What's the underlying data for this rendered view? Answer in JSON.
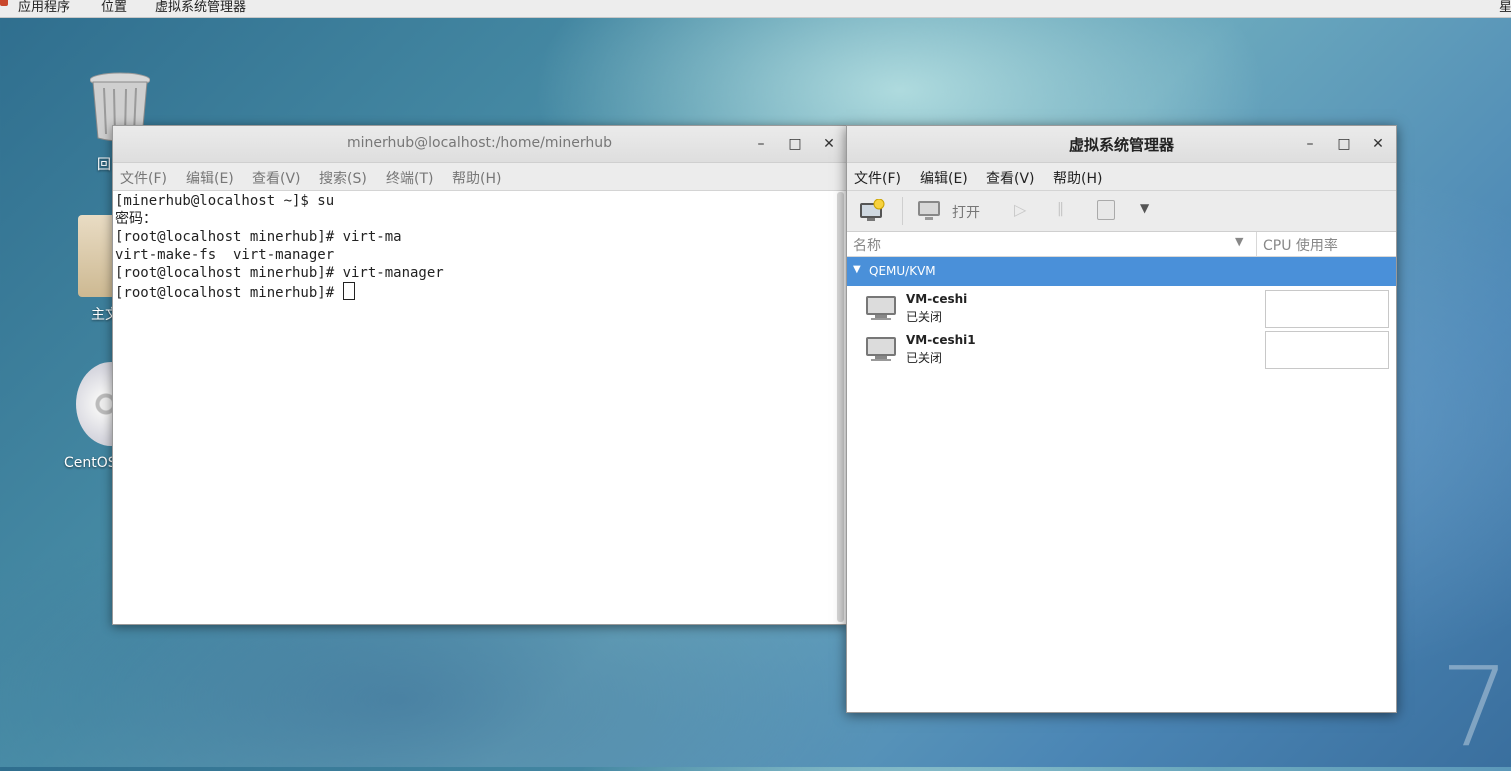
{
  "topbar": {
    "applications": "应用程序",
    "places": "位置",
    "active_app": "虚拟系统管理器",
    "right_clip": "星"
  },
  "desktop": {
    "trash_label": "回",
    "home_label": "主文",
    "disc_label": "CentOS",
    "wallpaper_number": "7"
  },
  "terminal": {
    "title": "minerhub@localhost:/home/minerhub",
    "menu": [
      "文件(F)",
      "编辑(E)",
      "查看(V)",
      "搜索(S)",
      "终端(T)",
      "帮助(H)"
    ],
    "lines": [
      "[minerhub@localhost ~]$ su",
      "密码：",
      "[root@localhost minerhub]# virt-ma",
      "virt-make-fs  virt-manager",
      "[root@localhost minerhub]# virt-manager",
      "[root@localhost minerhub]# "
    ]
  },
  "vmm": {
    "title": "虚拟系统管理器",
    "menu": [
      "文件(F)",
      "编辑(E)",
      "查看(V)",
      "帮助(H)"
    ],
    "toolbar": {
      "open_label": "打开"
    },
    "columns": {
      "name": "名称",
      "cpu": "CPU 使用率"
    },
    "group": "QEMU/KVM",
    "vms": [
      {
        "name": "VM-ceshi",
        "status": "已关闭"
      },
      {
        "name": "VM-ceshi1",
        "status": "已关闭"
      }
    ]
  },
  "colors": {
    "selection": "#4a90d9",
    "window_chrome": "#ececec"
  },
  "icons": [
    "minimize-icon",
    "maximize-icon",
    "close-icon",
    "new-vm-icon",
    "monitor-icon",
    "play-icon",
    "pause-icon",
    "shutdown-icon",
    "chevron-down-icon",
    "trash-icon",
    "folder-icon",
    "disc-icon"
  ]
}
